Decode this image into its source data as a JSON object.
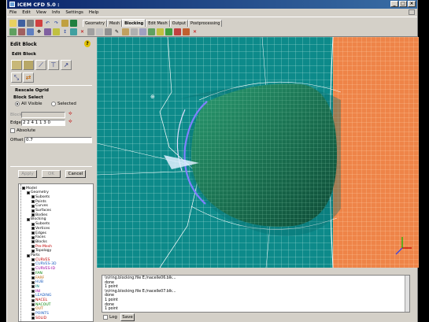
{
  "window": {
    "title": "ICEM CFD 5.0 :"
  },
  "menu": [
    "File",
    "Edit",
    "View",
    "Info",
    "Settings",
    "Help"
  ],
  "tabs": [
    {
      "label": "Geometry",
      "active": false
    },
    {
      "label": "Mesh",
      "active": false
    },
    {
      "label": "Blocking",
      "active": true
    },
    {
      "label": "Edit Mesh",
      "active": false
    },
    {
      "label": "Output",
      "active": false
    },
    {
      "label": "Postprocessing",
      "active": false
    }
  ],
  "panel": {
    "title": "Edit Block",
    "subtitle": "Edit Block",
    "rescale_title": "Rescale Ogrid",
    "block_select_label": "Block Select",
    "all_visible": "All Visible",
    "selected": "Selected",
    "selected_choice": "All Visible",
    "block_label": "Block",
    "block_value": "",
    "edge_label": "Edge",
    "edge_value": "2 2 4 1 1 3 0",
    "absolute_label": "Absolute",
    "absolute_checked": false,
    "offset_label": "Offset",
    "offset_value": "0.7",
    "apply": "Apply",
    "ok": "OK",
    "cancel": "Cancel"
  },
  "tree": [
    {
      "label": "Model",
      "level": 0,
      "color": "#000000"
    },
    {
      "label": "Geometry",
      "level": 1,
      "color": "#000000"
    },
    {
      "label": "Subsets",
      "level": 2,
      "color": "#000000"
    },
    {
      "label": "Points",
      "level": 2,
      "color": "#000000"
    },
    {
      "label": "Curves",
      "level": 2,
      "color": "#000000"
    },
    {
      "label": "Surfaces",
      "level": 2,
      "color": "#000000"
    },
    {
      "label": "Bodies",
      "level": 2,
      "color": "#000000"
    },
    {
      "label": "Blocking",
      "level": 1,
      "color": "#000000"
    },
    {
      "label": "Subsets",
      "level": 2,
      "color": "#000000"
    },
    {
      "label": "Vertices",
      "level": 2,
      "color": "#000000"
    },
    {
      "label": "Edges",
      "level": 2,
      "color": "#000000"
    },
    {
      "label": "Faces",
      "level": 2,
      "color": "#000000"
    },
    {
      "label": "Blocks",
      "level": 2,
      "color": "#000000"
    },
    {
      "label": "Pre-Mesh",
      "level": 2,
      "color": "#c00000"
    },
    {
      "label": "Topology",
      "level": 2,
      "color": "#000000"
    },
    {
      "label": "Parts",
      "level": 1,
      "color": "#000000"
    },
    {
      "label": "CURVES",
      "level": 2,
      "color": "#c00000"
    },
    {
      "label": "CURVES-3D",
      "level": 2,
      "color": "#2060c0"
    },
    {
      "label": "CURVES-ID",
      "level": 2,
      "color": "#a000a0"
    },
    {
      "label": "FAN",
      "level": 2,
      "color": "#008000"
    },
    {
      "label": "FARF",
      "level": 2,
      "color": "#c06000"
    },
    {
      "label": "HUB",
      "level": 2,
      "color": "#2060c0"
    },
    {
      "label": "IN",
      "level": 2,
      "color": "#008080"
    },
    {
      "label": "INI",
      "level": 2,
      "color": "#a000a0"
    },
    {
      "label": "LEADING",
      "level": 2,
      "color": "#2060c0"
    },
    {
      "label": "NACEL",
      "level": 2,
      "color": "#c00000"
    },
    {
      "label": "NACOUT",
      "level": 2,
      "color": "#008000"
    },
    {
      "label": "OUT",
      "level": 2,
      "color": "#c06000"
    },
    {
      "label": "POINTS",
      "level": 2,
      "color": "#2060c0"
    },
    {
      "label": "SOLID",
      "level": 2,
      "color": "#c00000"
    }
  ],
  "console": {
    "lines": [
      "\\n/ring.blocking.file E:/nacelle06.blk...",
      "done",
      "1 point",
      "\\n/ring.blocking.file E:/nacelle07.blk...",
      "done",
      "1 point",
      "done",
      "1 point"
    ],
    "log_label": "Log",
    "save_label": "Save"
  },
  "colors": {
    "accent": "#0a246a",
    "mesh_green": "#0d8a8a",
    "mesh_orange": "#f08a4a",
    "nacelle": "#1a7a5a"
  }
}
